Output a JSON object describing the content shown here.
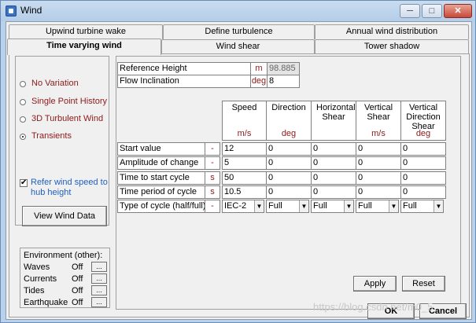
{
  "window": {
    "title": "Wind",
    "min_label": "─",
    "max_label": "□",
    "close_label": "✕"
  },
  "tabs": {
    "row1": [
      "Upwind turbine wake",
      "Define turbulence",
      "Annual wind distribution"
    ],
    "row2": [
      "Time varying wind",
      "Wind shear",
      "Tower shadow"
    ],
    "active": "Time varying wind"
  },
  "wind_options": {
    "items": [
      "No Variation",
      "Single Point History",
      "3D Turbulent Wind",
      "Transients"
    ],
    "selected": "Transients"
  },
  "refer_checkbox": {
    "label": "Refer wind speed to hub height",
    "checked": true,
    "check_mark": "✔"
  },
  "view_button": "View Wind Data",
  "environment": {
    "title": "Environment (other):",
    "rows": [
      {
        "name": "Waves",
        "value": "Off",
        "button": "..."
      },
      {
        "name": "Currents",
        "value": "Off",
        "button": "..."
      },
      {
        "name": "Tides",
        "value": "Off",
        "button": "..."
      },
      {
        "name": "Earthquake",
        "value": "Off",
        "button": "..."
      }
    ]
  },
  "reference": {
    "height_label": "Reference Height",
    "height_unit": "m",
    "height_value": "98.885",
    "incl_label": "Flow Inclination",
    "incl_unit": "deg",
    "incl_value": "8"
  },
  "columns": [
    {
      "title": "Speed",
      "unit": "m/s"
    },
    {
      "title": "Direction",
      "unit": "deg"
    },
    {
      "title": "Horizontal Shear",
      "unit": ""
    },
    {
      "title": "Vertical Shear",
      "unit": "m/s"
    },
    {
      "title": "Vertical Direction Shear",
      "unit": "deg"
    }
  ],
  "rows": [
    {
      "label": "Start value",
      "unit": "-",
      "values": [
        "12",
        "0",
        "0",
        "0",
        "0"
      ]
    },
    {
      "label": "Amplitude of change",
      "unit": "-",
      "values": [
        "5",
        "0",
        "0",
        "0",
        "0"
      ]
    },
    {
      "label": "Time to start cycle",
      "unit": "s",
      "values": [
        "50",
        "0",
        "0",
        "0",
        "0"
      ]
    },
    {
      "label": "Time period of cycle",
      "unit": "s",
      "values": [
        "10.5",
        "0",
        "0",
        "0",
        "0"
      ]
    }
  ],
  "cycle_row": {
    "label": "Type of cycle (half/full)",
    "unit": "-",
    "values": [
      "IEC-2",
      "Full",
      "Full",
      "Full",
      "Full"
    ]
  },
  "buttons": {
    "apply": "Apply",
    "reset": "Reset",
    "ok": "OK",
    "cancel": "Cancel"
  },
  "watermark": "https://blog.csdn.net/m0_5"
}
